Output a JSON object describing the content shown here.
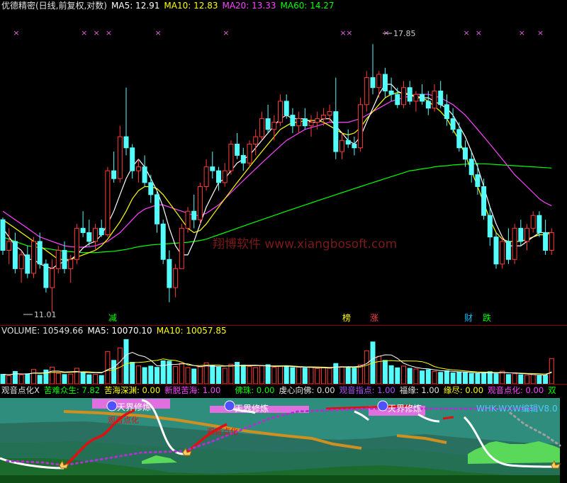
{
  "main_header": {
    "title": "优德精密(日线,前复权,对数)",
    "ma5_label": "MA5: 12.91",
    "ma10_label": "MA10: 12.83",
    "ma20_label": "MA20: 13.33",
    "ma60_label": "MA60: 14.27"
  },
  "annotations": {
    "high": "17.85",
    "low": "11.01",
    "watermark": "翔博软件 www.xiangbosoft.com",
    "tags": [
      "减",
      "榜",
      "涨",
      "财",
      "跌"
    ]
  },
  "volume_header": {
    "volume_label": "VOLUME: 10549.66",
    "ma5_label": "MA5: 10070.10",
    "ma10_label": "MA10: 10057.85"
  },
  "indicator_header": {
    "title": "观音点化X",
    "items": [
      "苦难众生: 7.82",
      "苦海深渊: 0.00",
      "新脱苦海: 1.00",
      "佛珠: 0.00",
      "虔心向佛: 0.00",
      "观音指点: 1.00",
      "福缘: 1.00",
      "缘尽: 0.00",
      "观音点化: 0.00",
      "双"
    ]
  },
  "indicator_labels": {
    "tianjie": "天界修炼",
    "guanyin": "观音点化",
    "brand": "WHK-WXW编辑V8.0"
  },
  "colors": {
    "up": "#ff3a3a",
    "down": "#54fcfc",
    "ma5": "#ffffff",
    "ma10": "#ffff00",
    "ma20": "#ff44ff",
    "ma60": "#00ff00"
  },
  "chart_data": {
    "type": "candlestick",
    "ohlc": [
      [
        13.0,
        13.05,
        12.2,
        12.3
      ],
      [
        12.3,
        12.8,
        12.0,
        12.5
      ],
      [
        12.5,
        12.7,
        11.8,
        11.9
      ],
      [
        11.9,
        12.3,
        11.6,
        12.2
      ],
      [
        12.2,
        12.4,
        11.7,
        11.8
      ],
      [
        11.8,
        12.6,
        11.7,
        12.5
      ],
      [
        12.5,
        12.7,
        11.9,
        12.0
      ],
      [
        12.0,
        12.1,
        11.4,
        11.5
      ],
      [
        11.5,
        12.1,
        11.01,
        11.9
      ],
      [
        11.9,
        12.4,
        11.8,
        12.3
      ],
      [
        12.3,
        12.5,
        11.8,
        11.9
      ],
      [
        11.9,
        12.2,
        11.6,
        12.1
      ],
      [
        12.1,
        12.9,
        12.0,
        12.8
      ],
      [
        12.8,
        13.2,
        12.6,
        12.7
      ],
      [
        12.7,
        13.0,
        12.4,
        12.5
      ],
      [
        12.5,
        12.9,
        12.3,
        12.8
      ],
      [
        12.8,
        13.0,
        12.6,
        12.65
      ],
      [
        12.65,
        14.3,
        12.6,
        14.2
      ],
      [
        14.2,
        14.7,
        13.9,
        14.0
      ],
      [
        14.0,
        15.4,
        13.9,
        15.1
      ],
      [
        15.1,
        16.5,
        14.6,
        14.8
      ],
      [
        14.8,
        14.9,
        14.0,
        14.2
      ],
      [
        14.2,
        14.5,
        13.9,
        14.3
      ],
      [
        14.3,
        14.6,
        13.8,
        13.9
      ],
      [
        13.9,
        14.1,
        13.4,
        13.6
      ],
      [
        13.6,
        13.7,
        12.7,
        12.9
      ],
      [
        12.9,
        13.0,
        12.0,
        12.1
      ],
      [
        12.1,
        12.3,
        11.2,
        11.5
      ],
      [
        11.5,
        12.0,
        11.3,
        11.9
      ],
      [
        11.9,
        12.9,
        11.9,
        12.8
      ],
      [
        12.8,
        13.3,
        12.7,
        13.2
      ],
      [
        13.2,
        13.6,
        12.8,
        13.0
      ],
      [
        13.0,
        13.9,
        12.9,
        13.8
      ],
      [
        13.8,
        14.5,
        13.7,
        14.3
      ],
      [
        14.3,
        14.7,
        14.0,
        14.2
      ],
      [
        14.2,
        14.3,
        13.7,
        13.9
      ],
      [
        13.9,
        14.4,
        13.8,
        14.2
      ],
      [
        14.2,
        15.0,
        14.1,
        14.9
      ],
      [
        14.9,
        15.2,
        14.5,
        14.6
      ],
      [
        14.6,
        14.8,
        14.2,
        14.4
      ],
      [
        14.4,
        15.0,
        14.3,
        14.9
      ],
      [
        14.9,
        15.3,
        14.6,
        15.1
      ],
      [
        15.1,
        15.8,
        15.0,
        15.6
      ],
      [
        15.6,
        16.0,
        15.2,
        15.3
      ],
      [
        15.3,
        15.7,
        15.0,
        15.5
      ],
      [
        15.5,
        16.3,
        15.4,
        16.1
      ],
      [
        16.1,
        16.3,
        15.6,
        15.7
      ],
      [
        15.7,
        15.9,
        15.2,
        15.4
      ],
      [
        15.4,
        15.8,
        15.2,
        15.6
      ],
      [
        15.6,
        15.9,
        15.3,
        15.4
      ],
      [
        15.4,
        15.7,
        15.1,
        15.5
      ],
      [
        15.5,
        15.8,
        15.3,
        15.6
      ],
      [
        15.6,
        15.9,
        15.4,
        15.7
      ],
      [
        15.7,
        16.0,
        15.5,
        15.8
      ],
      [
        15.8,
        16.8,
        14.5,
        14.7
      ],
      [
        14.7,
        15.2,
        14.5,
        15.0
      ],
      [
        15.0,
        15.3,
        14.8,
        14.9
      ],
      [
        14.9,
        15.1,
        14.6,
        14.8
      ],
      [
        14.8,
        16.2,
        14.7,
        16.0
      ],
      [
        16.0,
        17.0,
        15.8,
        16.8
      ],
      [
        16.8,
        17.85,
        16.3,
        16.5
      ],
      [
        16.5,
        17.0,
        16.2,
        16.9
      ],
      [
        16.9,
        17.1,
        16.2,
        16.4
      ],
      [
        16.4,
        16.8,
        16.1,
        16.3
      ],
      [
        16.3,
        16.5,
        15.9,
        16.0
      ],
      [
        16.0,
        16.7,
        15.9,
        16.5
      ],
      [
        16.5,
        16.7,
        16.0,
        16.1
      ],
      [
        16.1,
        16.4,
        15.8,
        16.3
      ],
      [
        16.3,
        16.6,
        16.0,
        16.1
      ],
      [
        16.1,
        16.4,
        15.7,
        15.9
      ],
      [
        15.9,
        16.6,
        15.8,
        16.4
      ],
      [
        16.4,
        16.7,
        15.9,
        16.0
      ],
      [
        16.0,
        16.3,
        15.4,
        15.6
      ],
      [
        15.6,
        15.9,
        15.2,
        15.3
      ],
      [
        15.3,
        15.5,
        14.7,
        14.8
      ],
      [
        14.8,
        15.0,
        14.3,
        14.5
      ],
      [
        14.5,
        14.7,
        13.9,
        14.1
      ],
      [
        14.1,
        14.4,
        13.6,
        13.8
      ],
      [
        13.8,
        14.0,
        13.0,
        13.1
      ],
      [
        13.1,
        13.3,
        12.4,
        12.6
      ],
      [
        12.6,
        12.7,
        11.9,
        12.0
      ],
      [
        12.0,
        12.6,
        11.9,
        12.5
      ],
      [
        12.5,
        12.8,
        12.0,
        12.1
      ],
      [
        12.1,
        12.9,
        12.0,
        12.8
      ],
      [
        12.8,
        13.0,
        12.4,
        12.5
      ],
      [
        12.5,
        12.9,
        12.3,
        12.8
      ],
      [
        12.8,
        13.2,
        12.7,
        13.1
      ],
      [
        13.1,
        13.2,
        12.6,
        12.7
      ],
      [
        12.7,
        13.0,
        12.2,
        12.3
      ],
      [
        12.3,
        12.8,
        12.2,
        12.7
      ]
    ],
    "ma5": [
      12.8,
      12.6,
      12.4,
      12.3,
      12.1,
      12.1,
      12.0,
      11.95,
      11.9,
      12.0,
      12.05,
      12.1,
      12.2,
      12.35,
      12.45,
      12.5,
      12.65,
      12.9,
      13.2,
      13.6,
      14.0,
      14.3,
      14.5,
      14.3,
      14.0,
      13.7,
      13.3,
      12.8,
      12.4,
      12.2,
      12.2,
      12.5,
      12.9,
      13.3,
      13.6,
      13.9,
      14.0,
      14.2,
      14.4,
      14.5,
      14.6,
      14.8,
      15.0,
      15.2,
      15.4,
      15.6,
      15.7,
      15.6,
      15.6,
      15.6,
      15.5,
      15.5,
      15.6,
      15.6,
      15.4,
      15.2,
      15.0,
      14.9,
      15.1,
      15.5,
      15.9,
      16.3,
      16.6,
      16.6,
      16.4,
      16.3,
      16.3,
      16.2,
      16.2,
      16.2,
      16.1,
      16.0,
      15.9,
      15.7,
      15.4,
      15.1,
      14.7,
      14.3,
      13.8,
      13.3,
      12.9,
      12.6,
      12.4,
      12.4,
      12.4,
      12.5,
      12.6,
      12.7,
      12.7,
      12.7
    ],
    "ma10": [
      13.0,
      12.9,
      12.8,
      12.7,
      12.6,
      12.5,
      12.4,
      12.3,
      12.2,
      12.1,
      12.1,
      12.1,
      12.15,
      12.2,
      12.25,
      12.3,
      12.4,
      12.55,
      12.75,
      12.95,
      13.2,
      13.5,
      13.7,
      13.8,
      13.8,
      13.75,
      13.6,
      13.4,
      13.2,
      13.0,
      12.8,
      12.7,
      12.75,
      12.9,
      13.1,
      13.3,
      13.5,
      13.7,
      13.9,
      14.1,
      14.3,
      14.5,
      14.7,
      14.9,
      15.1,
      15.3,
      15.4,
      15.5,
      15.5,
      15.55,
      15.55,
      15.55,
      15.5,
      15.4,
      15.3,
      15.2,
      15.15,
      15.2,
      15.35,
      15.6,
      15.8,
      16.0,
      16.2,
      16.3,
      16.35,
      16.35,
      16.3,
      16.25,
      16.2,
      16.1,
      15.95,
      15.8,
      15.6,
      15.3,
      15.0,
      14.6,
      14.2,
      13.8,
      13.4,
      13.0,
      12.7,
      12.55,
      12.5,
      12.5,
      12.5,
      12.55,
      12.6,
      12.65,
      12.65,
      12.7
    ],
    "ma20": [
      13.2,
      13.1,
      13.0,
      12.9,
      12.8,
      12.7,
      12.6,
      12.55,
      12.5,
      12.45,
      12.4,
      12.38,
      12.37,
      12.37,
      12.38,
      12.4,
      12.45,
      12.5,
      12.6,
      12.7,
      12.85,
      13.0,
      13.15,
      13.25,
      13.3,
      13.35,
      13.35,
      13.3,
      13.25,
      13.2,
      13.15,
      13.1,
      13.1,
      13.15,
      13.25,
      13.35,
      13.5,
      13.65,
      13.8,
      13.95,
      14.1,
      14.25,
      14.4,
      14.55,
      14.7,
      14.85,
      15.0,
      15.1,
      15.2,
      15.3,
      15.35,
      15.4,
      15.45,
      15.5,
      15.5,
      15.5,
      15.5,
      15.55,
      15.6,
      15.7,
      15.8,
      15.9,
      16.0,
      16.1,
      16.15,
      16.2,
      16.25,
      16.3,
      16.3,
      16.3,
      16.25,
      16.2,
      16.1,
      16.0,
      15.85,
      15.7,
      15.5,
      15.3,
      15.1,
      14.9,
      14.7,
      14.5,
      14.3,
      14.1,
      13.95,
      13.8,
      13.65,
      13.5,
      13.4,
      13.33
    ],
    "ma60": [
      12.6,
      12.55,
      12.5,
      12.45,
      12.4,
      12.38,
      12.36,
      12.34,
      12.32,
      12.3,
      12.28,
      12.27,
      12.26,
      12.25,
      12.25,
      12.25,
      12.26,
      12.27,
      12.28,
      12.3,
      12.32,
      12.35,
      12.38,
      12.4,
      12.42,
      12.43,
      12.44,
      12.45,
      12.46,
      12.47,
      12.48,
      12.5,
      12.52,
      12.55,
      12.6,
      12.65,
      12.7,
      12.75,
      12.8,
      12.85,
      12.9,
      12.95,
      13.0,
      13.05,
      13.1,
      13.15,
      13.2,
      13.25,
      13.3,
      13.35,
      13.4,
      13.45,
      13.5,
      13.55,
      13.6,
      13.65,
      13.7,
      13.75,
      13.8,
      13.85,
      13.9,
      13.95,
      14.0,
      14.05,
      14.1,
      14.15,
      14.2,
      14.22,
      14.25,
      14.27,
      14.3,
      14.32,
      14.33,
      14.35,
      14.36,
      14.37,
      14.38,
      14.38,
      14.38,
      14.37,
      14.36,
      14.35,
      14.34,
      14.33,
      14.32,
      14.31,
      14.3,
      14.29,
      14.28,
      14.27
    ],
    "volume": [
      4000,
      3500,
      5200,
      3800,
      4200,
      6000,
      3600,
      5800,
      7000,
      4400,
      3900,
      4100,
      6500,
      5000,
      3800,
      4000,
      3500,
      13500,
      9800,
      15000,
      18500,
      9000,
      7500,
      6800,
      7400,
      6900,
      9600,
      9500,
      7200,
      8600,
      6800,
      6200,
      7100,
      8800,
      7600,
      7000,
      6500,
      8200,
      9000,
      7800,
      7200,
      6800,
      7500,
      8000,
      6900,
      7400,
      7100,
      6800,
      7000,
      6600,
      6900,
      6400,
      6700,
      6500,
      8500,
      7200,
      6800,
      6600,
      7900,
      13800,
      17500,
      11500,
      9800,
      7600,
      6700,
      7400,
      6500,
      6200,
      5400,
      5900,
      5200,
      4800,
      5500,
      4600,
      5000,
      4700,
      4400,
      4300,
      4600,
      5100,
      4200,
      5300,
      3900,
      4200,
      3800,
      3600,
      3900,
      3400,
      3600,
      10549.66
    ],
    "xlabel": "",
    "ylabel": ""
  }
}
